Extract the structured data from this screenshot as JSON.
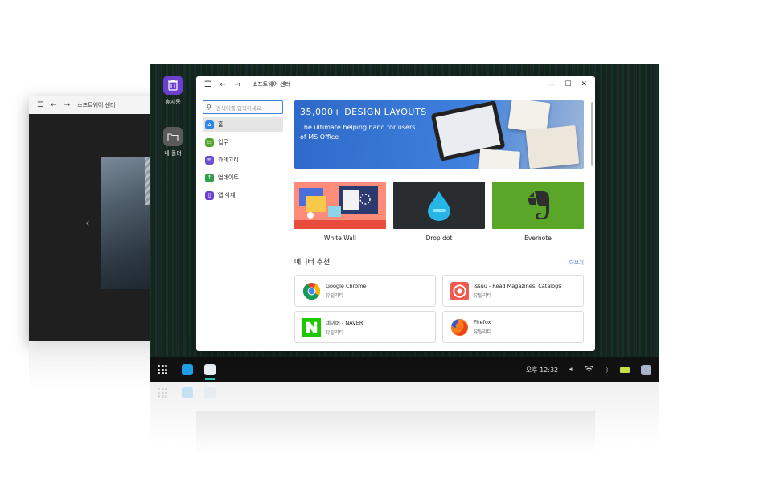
{
  "back_window": {
    "title": "소프트웨어 센터"
  },
  "desktop": {
    "icons": [
      {
        "label": "휴지통",
        "icon": "trash-icon"
      },
      {
        "label": "내 폴더",
        "icon": "folder-icon"
      }
    ]
  },
  "window": {
    "title": "소프트웨어 센터",
    "search_placeholder": "검색어를 입력하세요.",
    "nav": [
      {
        "label": "홈",
        "color": "#2f86e6",
        "icon": "home-icon"
      },
      {
        "label": "업무",
        "color": "#54a52e",
        "icon": "briefcase-icon"
      },
      {
        "label": "카테고리",
        "color": "#6b4fd0",
        "icon": "list-icon"
      },
      {
        "label": "업데이트",
        "color": "#2e9e47",
        "icon": "arrow-up-icon"
      },
      {
        "label": "앱 삭제",
        "color": "#6b3fcf",
        "icon": "trash-icon"
      }
    ],
    "banner": {
      "title": "35,000+ DESIGN LAYOUTS",
      "subtitle": "The ultimate helping hand for users of MS Office"
    },
    "featured": [
      {
        "label": "White Wall"
      },
      {
        "label": "Drop dot"
      },
      {
        "label": "Evernote"
      }
    ],
    "section": {
      "title": "에디터 추천",
      "more": "더보기"
    },
    "apps": [
      {
        "name": "Google Chrome",
        "category": "유틸리티",
        "icon": "chrome-icon"
      },
      {
        "name": "issuu - Read Magazines, Catalogs",
        "category": "유틸리티",
        "icon": "issuu-icon"
      },
      {
        "name": "네이버 - NAVER",
        "category": "유틸리티",
        "icon": "naver-icon"
      },
      {
        "name": "Firefox",
        "category": "유틸리티",
        "icon": "firefox-icon"
      }
    ]
  },
  "taskbar": {
    "time": "오후 12:32"
  },
  "colors": {
    "accent": "#3b82d6",
    "taskbar_indicator": "#2cc2b0"
  }
}
